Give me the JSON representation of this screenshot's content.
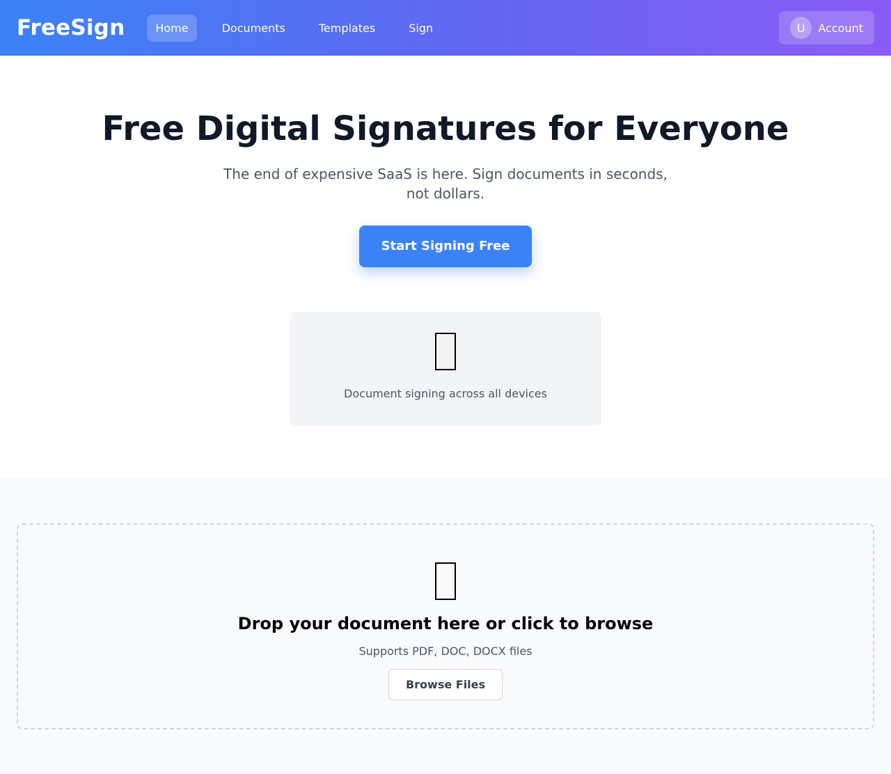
{
  "header": {
    "logo": "FreeSign",
    "nav": [
      {
        "label": "Home",
        "active": true
      },
      {
        "label": "Documents",
        "active": false
      },
      {
        "label": "Templates",
        "active": false
      },
      {
        "label": "Sign",
        "active": false
      }
    ],
    "account": {
      "avatar_initial": "U",
      "label": "Account"
    }
  },
  "hero": {
    "title": "Free Digital Signatures for Everyone",
    "subtitle": "The end of expensive SaaS is here. Sign documents in seconds, not dollars.",
    "cta_label": "Start Signing Free",
    "device_card": {
      "icon": "devices-icon",
      "caption": "Document signing across all devices"
    }
  },
  "upload": {
    "icon": "document-icon",
    "title": "Drop your document here or click to browse",
    "subtitle": "Supports PDF, DOC, DOCX files",
    "browse_label": "Browse Files"
  },
  "colors": {
    "primary": "#3b82f6",
    "gradient_start": "#3b82f6",
    "gradient_end": "#8b5cf6",
    "card_bg": "#f3f4f6",
    "section_bg": "#f9fafb"
  }
}
